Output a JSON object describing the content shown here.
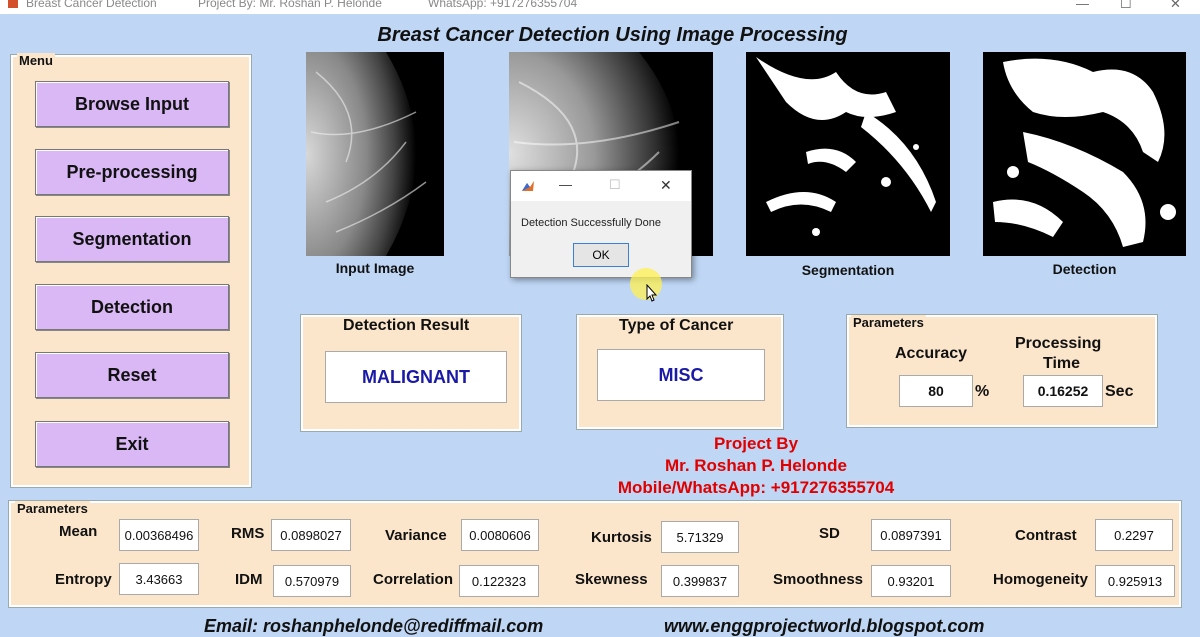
{
  "window": {
    "title": "Breast Cancer Detection",
    "project_by": "Project By: Mr. Roshan P. Helonde",
    "whatsapp": "WhatsApp: +917276355704",
    "ctrl_min": "—",
    "ctrl_max": "☐",
    "ctrl_close": "✕"
  },
  "main_title": "Breast Cancer Detection Using Image Processing",
  "menu": {
    "title": "Menu",
    "buttons": [
      "Browse Input",
      "Pre-processing",
      "Segmentation",
      "Detection",
      "Reset",
      "Exit"
    ]
  },
  "images": {
    "input_label": "Input Image",
    "segmentation_label": "Segmentation",
    "detection_label": "Detection"
  },
  "detection_result": {
    "title": "Detection Result",
    "value": "MALIGNANT"
  },
  "type_of_cancer": {
    "title": "Type of Cancer",
    "value": "MISC"
  },
  "parameters_top": {
    "title": "Parameters",
    "accuracy_label": "Accuracy",
    "accuracy_value": "80",
    "accuracy_unit": "%",
    "processing_label_1": "Processing",
    "processing_label_2": "Time",
    "processing_value": "0.16252",
    "processing_unit": "Sec"
  },
  "credits": {
    "line1": "Project By",
    "line2": "Mr. Roshan P. Helonde",
    "line3": "Mobile/WhatsApp: +917276355704"
  },
  "parameters_bottom": {
    "title": "Parameters",
    "mean_label": "Mean",
    "mean": "0.00368496",
    "rms_label": "RMS",
    "rms": "0.0898027",
    "variance_label": "Variance",
    "variance": "0.0080606",
    "kurtosis_label": "Kurtosis",
    "kurtosis": "5.71329",
    "sd_label": "SD",
    "sd": "0.0897391",
    "contrast_label": "Contrast",
    "contrast": "0.2297",
    "entropy_label": "Entropy",
    "entropy": "3.43663",
    "idm_label": "IDM",
    "idm": "0.570979",
    "correlation_label": "Correlation",
    "correlation": "0.122323",
    "skewness_label": "Skewness",
    "skewness": "0.399837",
    "smoothness_label": "Smoothness",
    "smoothness": "0.93201",
    "homogeneity_label": "Homogeneity",
    "homogeneity": "0.925913"
  },
  "footer": {
    "email": "Email: roshanphelonde@rediffmail.com",
    "website": "www.enggprojectworld.blogspot.com"
  },
  "dialog": {
    "ctrl_min": "—",
    "ctrl_max": "☐",
    "ctrl_close": "✕",
    "message": "Detection Successfully Done",
    "ok_label": "OK"
  }
}
